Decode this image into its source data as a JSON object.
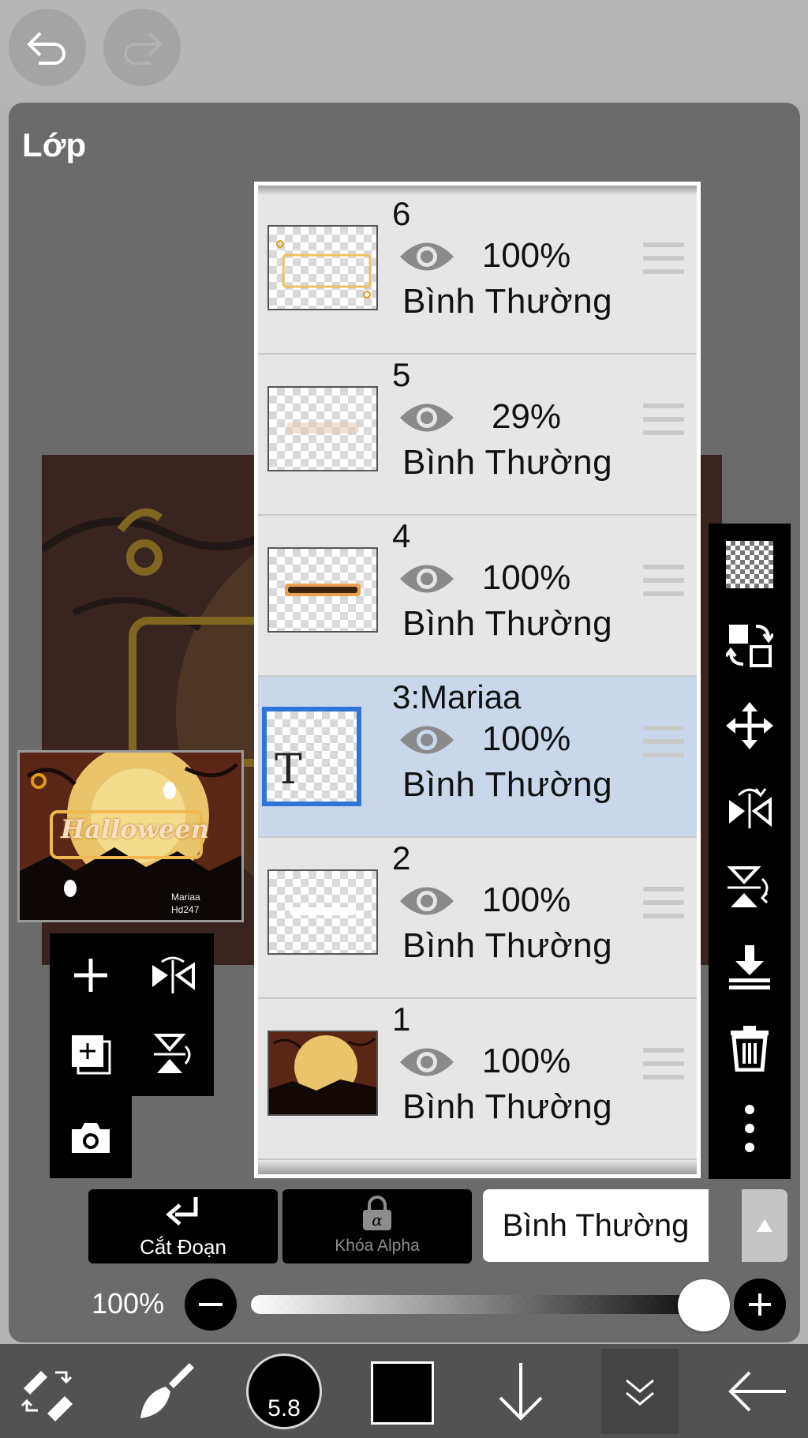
{
  "panel": {
    "title": "Lớp"
  },
  "preview": {
    "title_text": "Halloween",
    "signature": "Mariaa",
    "watermark": "Hd247"
  },
  "layers": [
    {
      "number": "6",
      "opacity": "100%",
      "blend": "Bình Thường",
      "selected": false
    },
    {
      "number": "5",
      "opacity": "29%",
      "blend": "Bình Thường",
      "selected": false
    },
    {
      "number": "4",
      "opacity": "100%",
      "blend": "Bình Thường",
      "selected": false
    },
    {
      "number": "3:Mariaa",
      "opacity": "100%",
      "blend": "Bình Thường",
      "selected": true,
      "thumb_glyph": "T"
    },
    {
      "number": "2",
      "opacity": "100%",
      "blend": "Bình Thường",
      "selected": false
    },
    {
      "number": "1",
      "opacity": "100%",
      "blend": "Bình Thường",
      "selected": false
    }
  ],
  "bottom_controls": {
    "clipping_label": "Cắt Đoạn",
    "alpha_lock_label": "Khóa Alpha",
    "blend_mode": "Bình Thường",
    "opacity_label": "100%",
    "opacity_value": 1.0
  },
  "toolbar": {
    "brush_size": "5.8",
    "color": "#000000"
  },
  "colors": {
    "accent": "#2f74d6",
    "selected_row": "#cad7ea"
  }
}
